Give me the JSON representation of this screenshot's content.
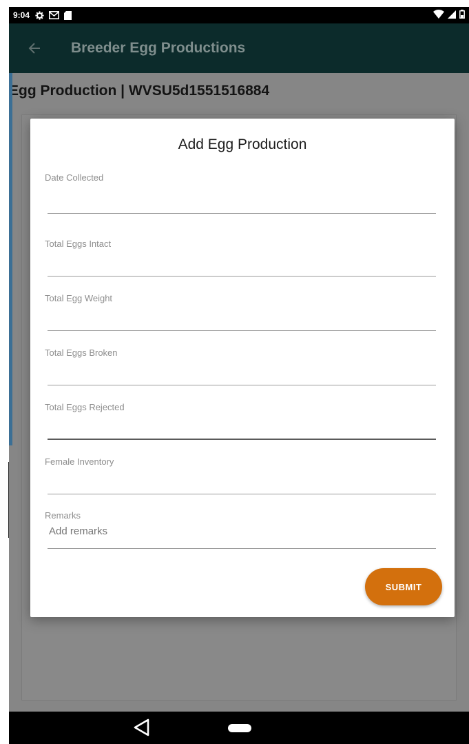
{
  "status_bar": {
    "time": "9:04",
    "icons": [
      "gear-icon",
      "mail-icon",
      "sd-card-icon",
      "wifi-icon",
      "signal-icon",
      "battery-icon"
    ]
  },
  "app_bar": {
    "title": "Breeder Egg Productions",
    "back_icon": "arrow-left-icon"
  },
  "page": {
    "title": "Egg Production | WVSU5d1551516884"
  },
  "dialog": {
    "title": "Add Egg Production",
    "fields": [
      {
        "label": "Date Collected",
        "value": ""
      },
      {
        "label": "Total Eggs Intact",
        "value": ""
      },
      {
        "label": "Total Egg Weight",
        "value": ""
      },
      {
        "label": "Total Eggs Broken",
        "value": ""
      },
      {
        "label": "Total Eggs Rejected",
        "value": ""
      },
      {
        "label": "Female Inventory",
        "value": ""
      },
      {
        "label": "Remarks",
        "value": "",
        "placeholder": "Add remarks"
      }
    ],
    "submit_label": "SUBMIT"
  },
  "fab": {
    "icon": "plus-icon",
    "label": "+"
  },
  "colors": {
    "app_bar": "#0c2b2b",
    "accent": "#d3700d",
    "fab": "#6a3a05"
  }
}
